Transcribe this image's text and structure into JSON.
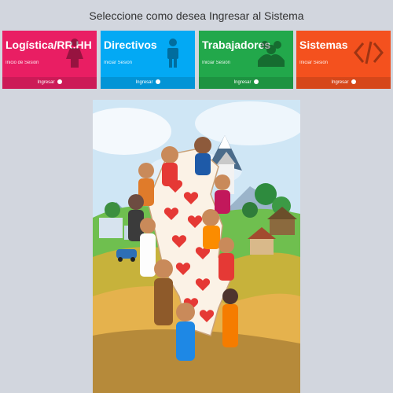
{
  "header": {
    "title": "Seleccione como desea Ingresar al Sistema"
  },
  "tiles": [
    {
      "name": "Logística/RR.HH",
      "sub": "Inicio de Sesión",
      "footer": "Ingresar",
      "color": "#e91e63",
      "icon": "female-person-icon"
    },
    {
      "name": "Directivos",
      "sub": "Iniciar Sesión",
      "footer": "Ingresar",
      "color": "#03a9f4",
      "icon": "person-icon"
    },
    {
      "name": "Trabajadores",
      "sub": "Iniciar Sesión",
      "footer": "Ingresar",
      "color": "#22a84b",
      "icon": "group-icon"
    },
    {
      "name": "Sistemas",
      "sub": "Iniciar Sesión",
      "footer": "Ingresar",
      "color": "#f4511e",
      "icon": "code-icon"
    }
  ]
}
